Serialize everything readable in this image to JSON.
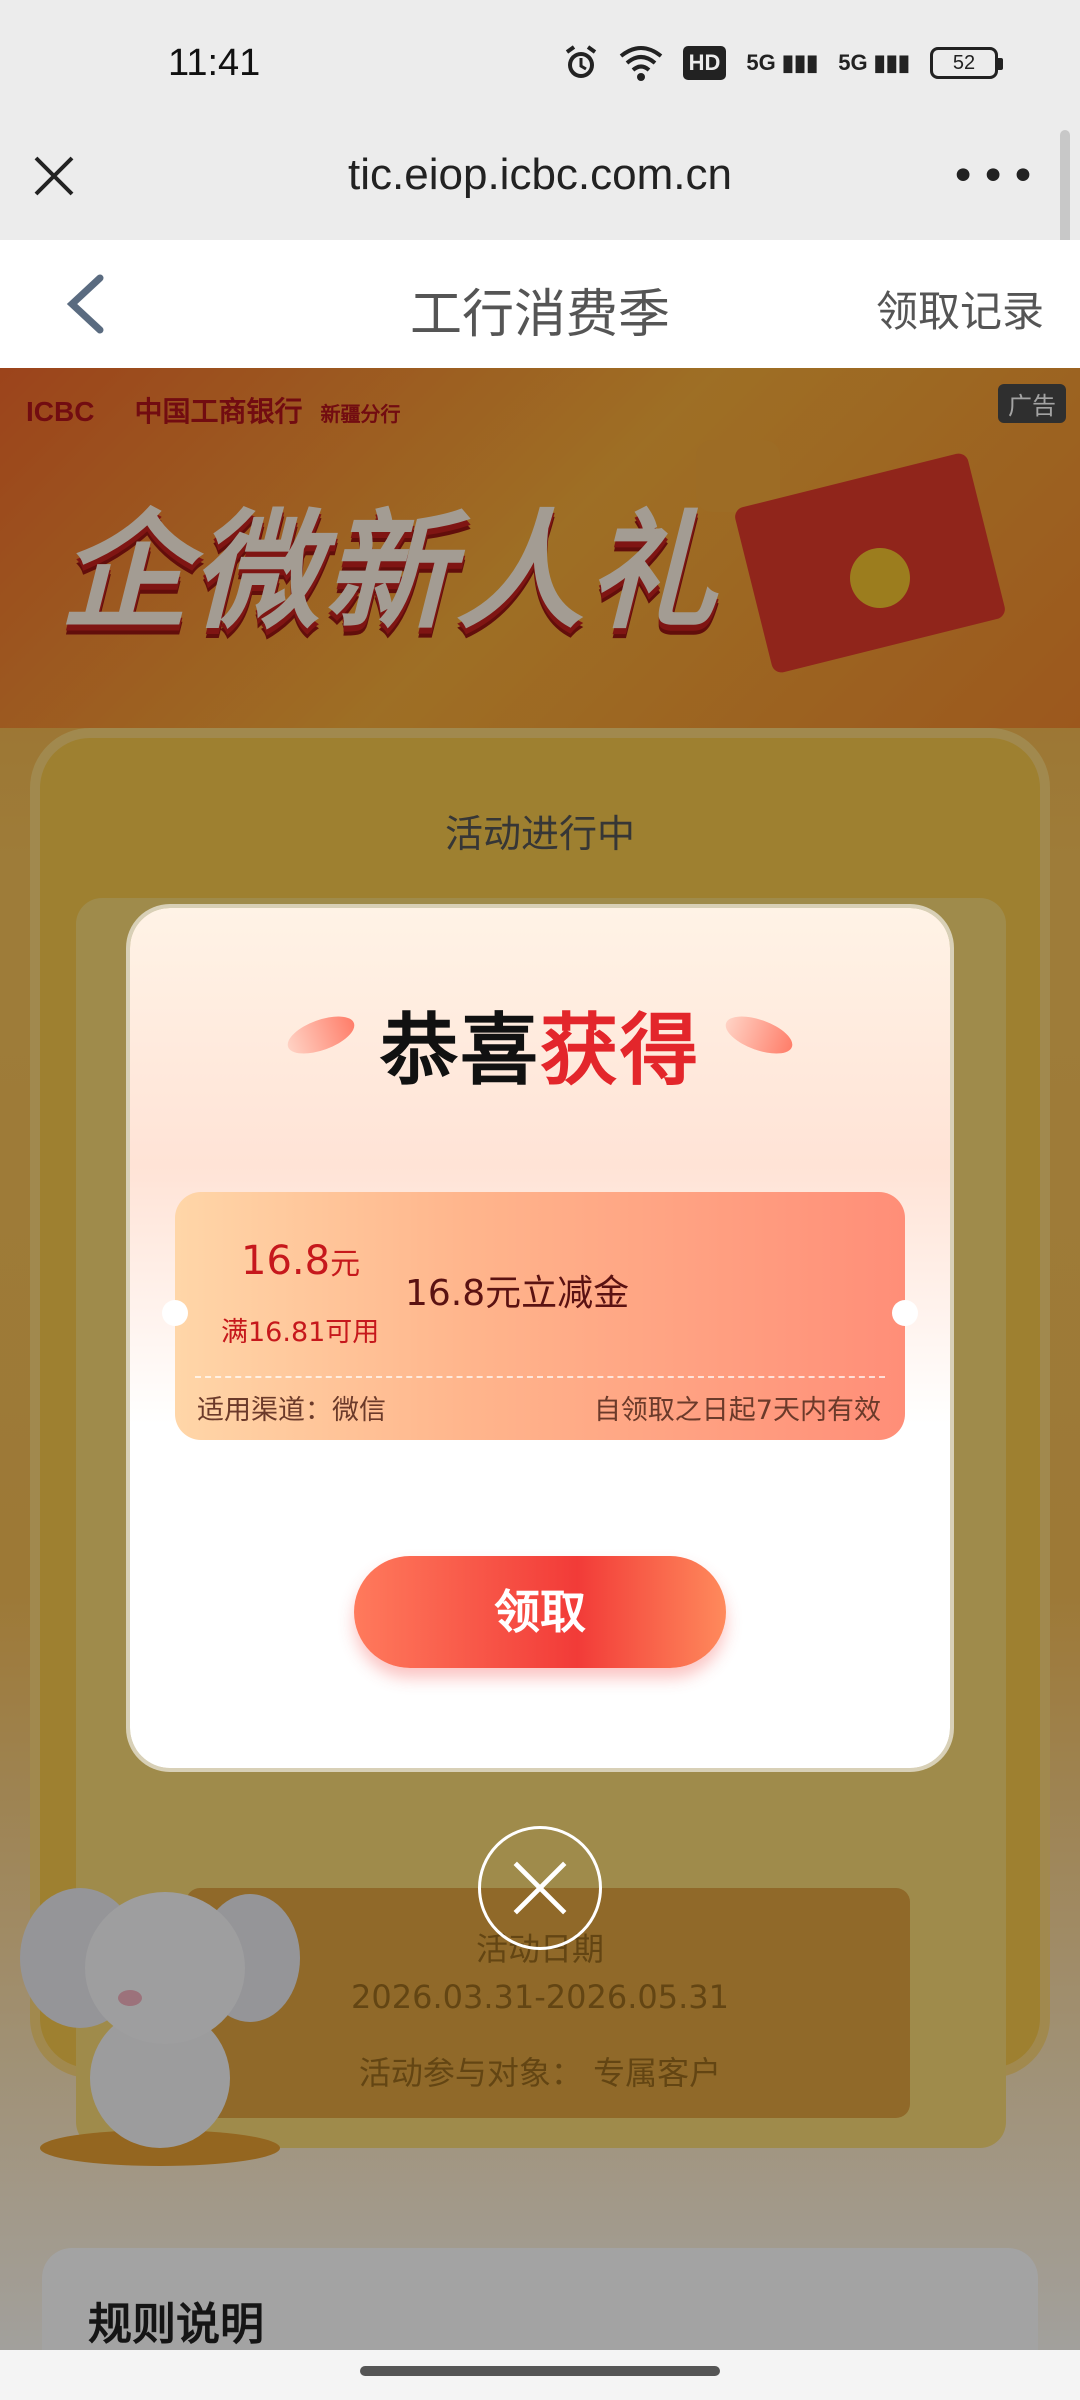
{
  "status_bar": {
    "time": "11:41",
    "network": "5G",
    "battery": "52",
    "wifi_icon": "wifi-icon",
    "alarm_icon": "alarm-icon",
    "hd_badge": "HD"
  },
  "browser": {
    "url": "tic.eiop.icbc.com.cn",
    "close_icon": "close-icon",
    "more_icon": "more-icon"
  },
  "header": {
    "title": "工行消费季",
    "records": "领取记录"
  },
  "banner": {
    "logo_en": "ICBC",
    "logo_cn": "中国工商银行",
    "branch": "新疆分行",
    "ad_label": "广告",
    "title": "企微新人礼"
  },
  "activity": {
    "status": "活动进行中",
    "date_label": "活动日期",
    "dates": "2026.03.31-2026.05.31",
    "target": "活动参与对象： 专属客户"
  },
  "rules": {
    "title": "规则说明"
  },
  "modal": {
    "title_black": "恭喜",
    "title_red": "获得",
    "coupon": {
      "amount": "16.8",
      "unit": "元",
      "condition": "满16.81可用",
      "name": "16.8元立减金",
      "channel": "适用渠道：微信",
      "validity": "自领取之日起7天内有效"
    },
    "claim_button": "领取"
  },
  "colors": {
    "accent_red": "#e3262b",
    "button_red": "#f23b38",
    "coupon_text": "#c6181c"
  }
}
